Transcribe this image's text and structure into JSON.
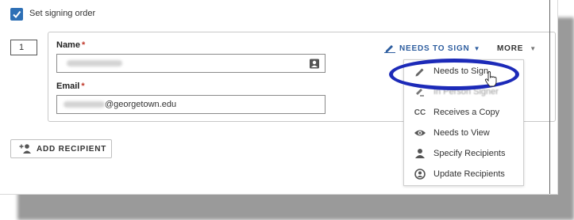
{
  "signing_order": {
    "label": "Set signing order",
    "checked": true
  },
  "recipient": {
    "order_value": "1",
    "name_label": "Name",
    "email_label": "Email",
    "required_marker": "*",
    "email_visible_suffix": "@georgetown.edu"
  },
  "actions": {
    "role_button_label": "NEEDS TO SIGN",
    "more_label": "MORE",
    "add_recipient_label": "ADD RECIPIENT"
  },
  "role_menu": {
    "items": [
      {
        "label": "Needs to Sign",
        "icon": "pen-icon"
      },
      {
        "label": "In Person Signer",
        "icon": "in-person-signer-icon"
      },
      {
        "label": "Receives a Copy",
        "icon": "cc-icon"
      },
      {
        "label": "Needs to View",
        "icon": "eye-icon"
      },
      {
        "label": "Specify Recipients",
        "icon": "person-icon"
      },
      {
        "label": "Update Recipients",
        "icon": "update-person-icon"
      }
    ]
  },
  "colors": {
    "accent": "#2d5d9f",
    "checkbox": "#2d6fb5",
    "highlight": "#1c2ab8",
    "required": "#c0392b"
  }
}
